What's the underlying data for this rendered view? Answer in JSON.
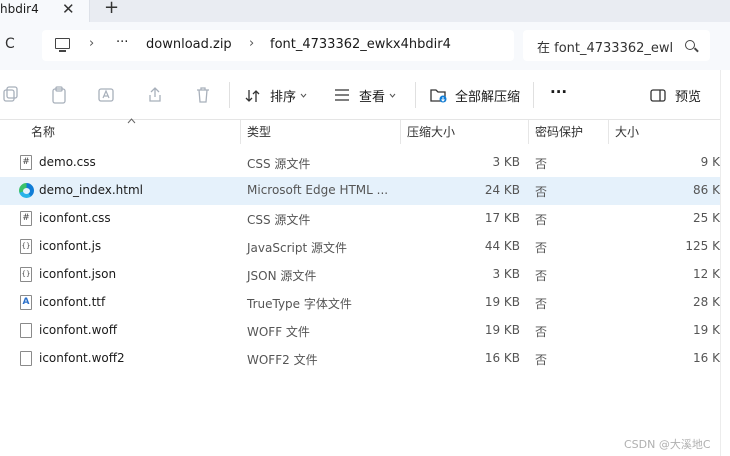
{
  "tab": {
    "title": "hbdir4",
    "close": "✕",
    "new": "+"
  },
  "address": {
    "refresh": "C",
    "sep": "›",
    "more": "···",
    "crumb1": "download.zip",
    "crumb2": "font_4733362_ewkx4hbdir4",
    "search_placeholder": "在 font_4733362_ewl"
  },
  "toolbar": {
    "sort_label": "排序",
    "view_label": "查看",
    "extract_label": "全部解压缩",
    "more": "···",
    "preview_label": "预览"
  },
  "columns": {
    "name": "名称",
    "type": "类型",
    "compressed": "压缩大小",
    "protected": "密码保护",
    "size": "大小"
  },
  "files": [
    {
      "icon": "css-file-icon",
      "glyph": "#",
      "name": "demo.css",
      "type": "CSS 源文件",
      "compressed": "3 KB",
      "protected": "否",
      "size": "9 K"
    },
    {
      "icon": "edge-icon",
      "glyph": "",
      "name": "demo_index.html",
      "type": "Microsoft Edge HTML ...",
      "compressed": "24 KB",
      "protected": "否",
      "size": "86 K"
    },
    {
      "icon": "css-file-icon",
      "glyph": "#",
      "name": "iconfont.css",
      "type": "CSS 源文件",
      "compressed": "17 KB",
      "protected": "否",
      "size": "25 K"
    },
    {
      "icon": "js-file-icon",
      "glyph": "{}",
      "name": "iconfont.js",
      "type": "JavaScript 源文件",
      "compressed": "44 KB",
      "protected": "否",
      "size": "125 K"
    },
    {
      "icon": "json-file-icon",
      "glyph": "{}",
      "name": "iconfont.json",
      "type": "JSON 源文件",
      "compressed": "3 KB",
      "protected": "否",
      "size": "12 K"
    },
    {
      "icon": "font-file-icon",
      "glyph": "A",
      "name": "iconfont.ttf",
      "type": "TrueType 字体文件",
      "compressed": "19 KB",
      "protected": "否",
      "size": "28 K"
    },
    {
      "icon": "blank-file-icon",
      "glyph": "",
      "name": "iconfont.woff",
      "type": "WOFF 文件",
      "compressed": "19 KB",
      "protected": "否",
      "size": "19 K"
    },
    {
      "icon": "blank-file-icon",
      "glyph": "",
      "name": "iconfont.woff2",
      "type": "WOFF2 文件",
      "compressed": "16 KB",
      "protected": "否",
      "size": "16 K"
    }
  ],
  "watermark": "CSDN @大溪地C",
  "colors": {
    "selected_row": "#e5f1fb",
    "accent": "#0f7cd6"
  }
}
